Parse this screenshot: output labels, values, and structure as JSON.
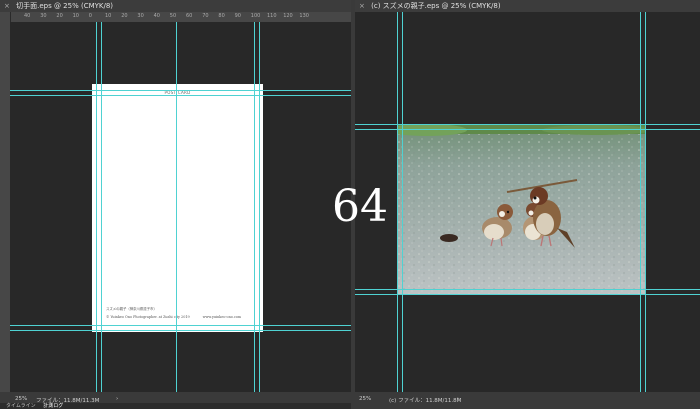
{
  "left_doc": {
    "tab_title": "切手面.eps @ 25% (CMYK/8)",
    "ruler_ticks": [
      "40",
      "30",
      "20",
      "10",
      "0",
      "10",
      "20",
      "30",
      "40",
      "50",
      "60",
      "70",
      "80",
      "90",
      "100",
      "110",
      "120",
      "130"
    ],
    "postcard": {
      "title": "POST CARD",
      "caption": "スズメの親子（神奈川県逗子市）",
      "credit": "© Yuinkeo Ono Photographer. at Zushi city 2019",
      "url": "www.yuinkeo-ono.com"
    },
    "status": {
      "zoom": "25%",
      "file_info": "ファイル：11.8M/11.3M",
      "arrow": "›"
    }
  },
  "right_doc": {
    "tab_title": "(c) スズメの親子.eps @ 25% (CMYK/8)",
    "status": {
      "zoom": "25%",
      "file_info": "(c) ファイル：11.8M/11.8M",
      "arrow": "›"
    }
  },
  "bottom_tabs": [
    "タイムライン",
    "計測ログ"
  ],
  "overlay_number": "64",
  "icons": {
    "tab_close": "×"
  },
  "colors": {
    "guide": "#4fd2d2",
    "panel_bg": "#282828"
  }
}
